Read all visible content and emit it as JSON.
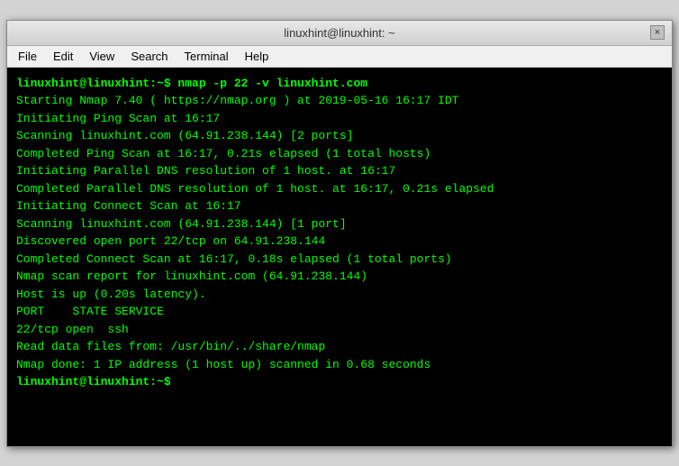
{
  "titleBar": {
    "title": "linuxhint@linuxhint: ~",
    "closeLabel": "×"
  },
  "menuBar": {
    "items": [
      "File",
      "Edit",
      "View",
      "Search",
      "Terminal",
      "Help"
    ]
  },
  "terminal": {
    "lines": [
      {
        "text": "linuxhint@linuxhint:~$ nmap -p 22 -v linuxhint.com",
        "bold": true
      },
      {
        "text": "",
        "bold": false
      },
      {
        "text": "Starting Nmap 7.40 ( https://nmap.org ) at 2019-05-16 16:17 IDT",
        "bold": false
      },
      {
        "text": "Initiating Ping Scan at 16:17",
        "bold": false
      },
      {
        "text": "Scanning linuxhint.com (64.91.238.144) [2 ports]",
        "bold": false
      },
      {
        "text": "Completed Ping Scan at 16:17, 0.21s elapsed (1 total hosts)",
        "bold": false
      },
      {
        "text": "Initiating Parallel DNS resolution of 1 host. at 16:17",
        "bold": false
      },
      {
        "text": "Completed Parallel DNS resolution of 1 host. at 16:17, 0.21s elapsed",
        "bold": false
      },
      {
        "text": "Initiating Connect Scan at 16:17",
        "bold": false
      },
      {
        "text": "Scanning linuxhint.com (64.91.238.144) [1 port]",
        "bold": false
      },
      {
        "text": "Discovered open port 22/tcp on 64.91.238.144",
        "bold": false
      },
      {
        "text": "Completed Connect Scan at 16:17, 0.18s elapsed (1 total ports)",
        "bold": false
      },
      {
        "text": "Nmap scan report for linuxhint.com (64.91.238.144)",
        "bold": false
      },
      {
        "text": "Host is up (0.20s latency).",
        "bold": false
      },
      {
        "text": "PORT    STATE SERVICE",
        "bold": false
      },
      {
        "text": "22/tcp open  ssh",
        "bold": false
      },
      {
        "text": "",
        "bold": false
      },
      {
        "text": "Read data files from: /usr/bin/../share/nmap",
        "bold": false
      },
      {
        "text": "Nmap done: 1 IP address (1 host up) scanned in 0.68 seconds",
        "bold": false
      },
      {
        "text": "linuxhint@linuxhint:~$",
        "bold": true
      }
    ]
  }
}
